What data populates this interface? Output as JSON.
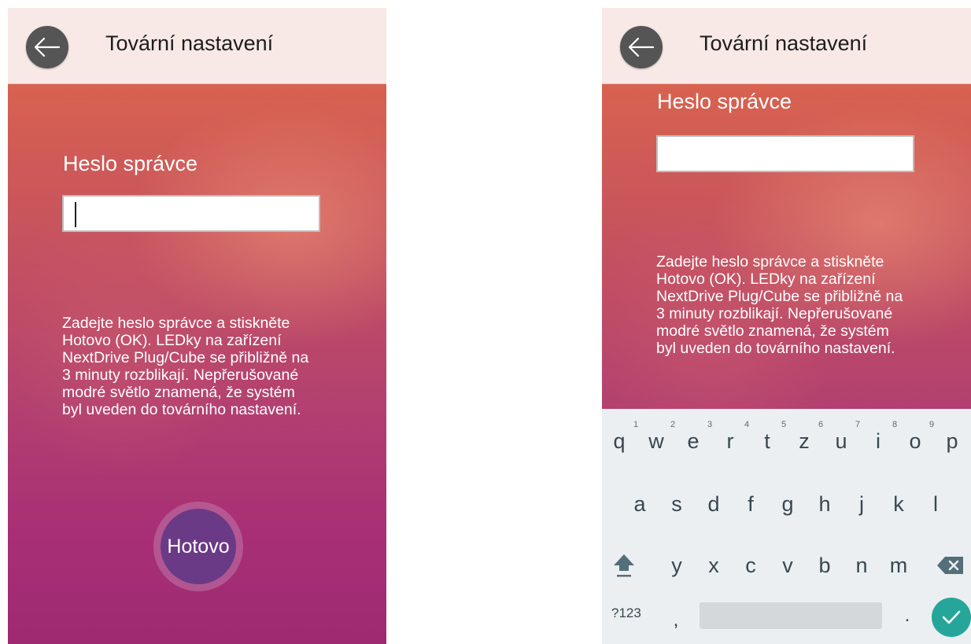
{
  "screen_left": {
    "title": "Tovární nastavení",
    "password_label": "Heslo správce",
    "password_value": "",
    "description_lines": [
      "Zadejte heslo správce a stiskněte",
      "Hotovo (OK). LEDky na zařízení",
      "NextDrive Plug/Cube se přibližně na",
      "3 minuty rozblikají. Nepřerušované",
      "modré světlo znamená, že systém",
      "byl uveden do továrního nastavení."
    ],
    "done_label": "Hotovo"
  },
  "screen_right": {
    "title": "Tovární nastavení",
    "password_label": "Heslo správce",
    "password_value": "",
    "description_lines": [
      "Zadejte heslo správce a stiskněte",
      "Hotovo (OK). LEDky na zařízení",
      "NextDrive Plug/Cube se přibližně na",
      "3 minuty rozblikají. Nepřerušované",
      "modré světlo znamená, že systém",
      "byl uveden do továrního nastavení."
    ]
  },
  "keyboard": {
    "row1": [
      "q",
      "w",
      "e",
      "r",
      "t",
      "z",
      "u",
      "i",
      "o",
      "p"
    ],
    "row1_hints": [
      "1",
      "2",
      "3",
      "4",
      "5",
      "6",
      "7",
      "8",
      "9"
    ],
    "row2": [
      "a",
      "s",
      "d",
      "f",
      "g",
      "h",
      "j",
      "k",
      "l"
    ],
    "row3": [
      "y",
      "x",
      "c",
      "v",
      "b",
      "n",
      "m"
    ],
    "symbols_label": "?123",
    "comma": ",",
    "period": ".",
    "icons": [
      "shift-icon",
      "backspace-icon",
      "check-icon",
      "back-arrow-icon"
    ]
  },
  "colors": {
    "header_bg": "#f8e8e6",
    "gradient_top": "#d8624f",
    "gradient_bottom": "#9e2a72",
    "done_button": "#6b3a86",
    "keyboard_bg": "#eceff1",
    "enter_key": "#26a69a"
  }
}
